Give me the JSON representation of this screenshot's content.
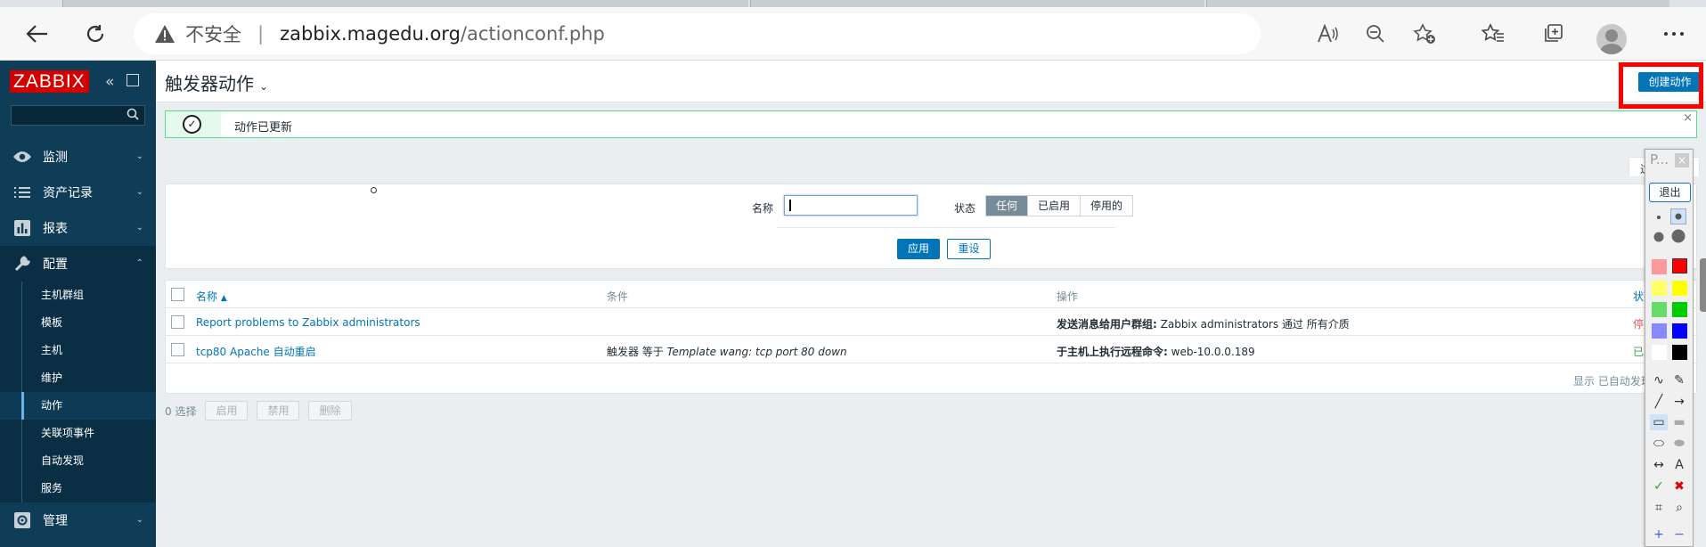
{
  "browser": {
    "security_label": "不安全",
    "url_host": "zabbix.magedu.org",
    "url_path": "/actionconf.php",
    "icons": [
      "back-icon",
      "refresh-icon",
      "read-aloud-icon",
      "zoom-out-icon",
      "add-favorite-icon",
      "favorites-icon",
      "collections-icon",
      "profile-avatar",
      "more-icon"
    ]
  },
  "sidebar": {
    "logo": "ZABBIX",
    "menu": [
      {
        "label": "监测",
        "icon": "eye-icon"
      },
      {
        "label": "资产记录",
        "icon": "list-icon"
      },
      {
        "label": "报表",
        "icon": "bar-chart-icon"
      },
      {
        "label": "配置",
        "icon": "wrench-icon"
      }
    ],
    "config_sub": [
      "主机群组",
      "模板",
      "主机",
      "维护",
      "动作",
      "关联项事件",
      "自动发现",
      "服务"
    ],
    "admin": {
      "label": "管理",
      "icon": "gear-icon"
    }
  },
  "header": {
    "title": "触发器动作",
    "create_button": "创建动作"
  },
  "message": {
    "text": "动作已更新"
  },
  "filter": {
    "tab_label": "过",
    "name_label": "名称",
    "name_value": "",
    "status_label": "状态",
    "status_options": [
      "任何",
      "已启用",
      "停用的"
    ],
    "status_selected": "任何",
    "apply": "应用",
    "reset": "重设"
  },
  "table": {
    "columns": [
      "名称",
      "条件",
      "操作",
      "状态"
    ],
    "rows": [
      {
        "name": "Report problems to Zabbix administrators",
        "condition_prefix": "",
        "condition_em": "",
        "operation_bold": "发送消息给用户群组:",
        "operation_rest": " Zabbix administrators 通过 所有介质",
        "status": "停用"
      },
      {
        "name": "tcp80 Apache 自动重启",
        "condition_prefix": "触发器 等于 ",
        "condition_em": "Template wang: tcp port 80 down",
        "operation_bold": "于主机上执行远程命令:",
        "operation_rest": " web-10.0.0.189",
        "status": "已启"
      }
    ],
    "footer": "显示 已自动发现"
  },
  "bulk": {
    "selected": "0 选择",
    "buttons": [
      "启用",
      "禁用",
      "删除"
    ]
  },
  "palette": {
    "title": "P...",
    "exit": "退出",
    "colors": [
      "#ff9999",
      "#ff0000",
      "#ffff66",
      "#ffff00",
      "#66dd66",
      "#00cc00",
      "#8888ff",
      "#0000ff",
      "#ffffff",
      "#000000"
    ]
  }
}
